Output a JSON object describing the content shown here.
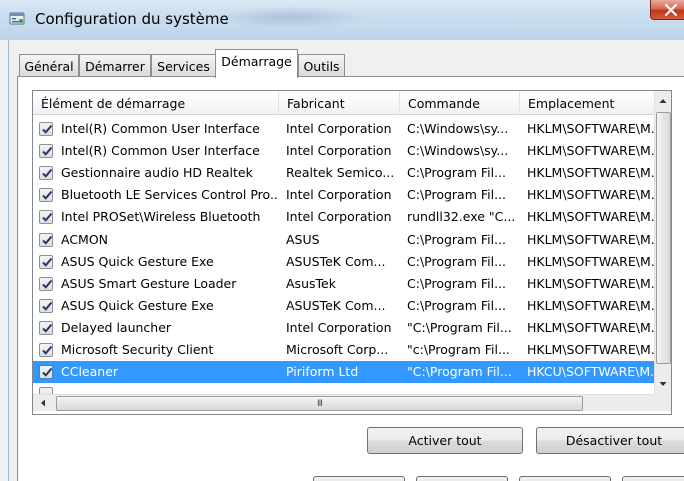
{
  "window": {
    "title": "Configuration du système",
    "icon": "msconfig-icon",
    "close_icon": "close-icon"
  },
  "tabs": [
    {
      "label": "Général",
      "active": false
    },
    {
      "label": "Démarrer",
      "active": false
    },
    {
      "label": "Services",
      "active": false
    },
    {
      "label": "Démarrage",
      "active": true
    },
    {
      "label": "Outils",
      "active": false
    }
  ],
  "startup_list": {
    "columns": [
      "Élément de démarrage",
      "Fabricant",
      "Commande",
      "Emplacement"
    ],
    "rows": [
      {
        "checked": true,
        "item": "Intel(R) Common User Interface",
        "maker": "Intel Corporation",
        "command": "C:\\Windows\\sy...",
        "location": "HKLM\\SOFTWARE\\M..."
      },
      {
        "checked": true,
        "item": "Intel(R) Common User Interface",
        "maker": "Intel Corporation",
        "command": "C:\\Windows\\sy...",
        "location": "HKLM\\SOFTWARE\\M..."
      },
      {
        "checked": true,
        "item": "Gestionnaire audio HD Realtek",
        "maker": "Realtek Semico...",
        "command": "C:\\Program Fil...",
        "location": "HKLM\\SOFTWARE\\M..."
      },
      {
        "checked": true,
        "item": "Bluetooth LE Services Control Pro...",
        "maker": "Intel Corporation",
        "command": "C:\\Program Fil...",
        "location": "HKLM\\SOFTWARE\\M..."
      },
      {
        "checked": true,
        "item": "Intel PROSet\\Wireless Bluetooth",
        "maker": "Intel Corporation",
        "command": "rundll32.exe \"C...",
        "location": "HKLM\\SOFTWARE\\M..."
      },
      {
        "checked": true,
        "item": "ACMON",
        "maker": "ASUS",
        "command": "C:\\Program Fil...",
        "location": "HKLM\\SOFTWARE\\M..."
      },
      {
        "checked": true,
        "item": "ASUS Quick Gesture Exe",
        "maker": "ASUSTeK Com...",
        "command": "C:\\Program Fil...",
        "location": "HKLM\\SOFTWARE\\M..."
      },
      {
        "checked": true,
        "item": "ASUS Smart Gesture Loader",
        "maker": "AsusTek",
        "command": "C:\\Program Fil...",
        "location": "HKLM\\SOFTWARE\\M..."
      },
      {
        "checked": true,
        "item": "ASUS Quick Gesture Exe",
        "maker": "ASUSTeK Com...",
        "command": "C:\\Program Fil...",
        "location": "HKLM\\SOFTWARE\\M..."
      },
      {
        "checked": true,
        "item": "Delayed launcher",
        "maker": "Intel Corporation",
        "command": "\"C:\\Program Fil...",
        "location": "HKLM\\SOFTWARE\\M..."
      },
      {
        "checked": true,
        "item": "Microsoft Security Client",
        "maker": "Microsoft Corp...",
        "command": "\"c:\\Program Fil...",
        "location": "HKLM\\SOFTWARE\\M..."
      },
      {
        "checked": true,
        "item": "CCleaner",
        "maker": "Piriform Ltd",
        "command": "\"C:\\Program Fil...",
        "location": "HKCU\\SOFTWARE\\M...",
        "selected": true
      }
    ]
  },
  "buttons": {
    "enable_all": "Activer tout",
    "disable_all": "Désactiver tout"
  },
  "scrollbar_grip": "III",
  "colors": {
    "selection": "#3399ff",
    "titlebar": "#c9dcef",
    "close": "#c2351a"
  }
}
